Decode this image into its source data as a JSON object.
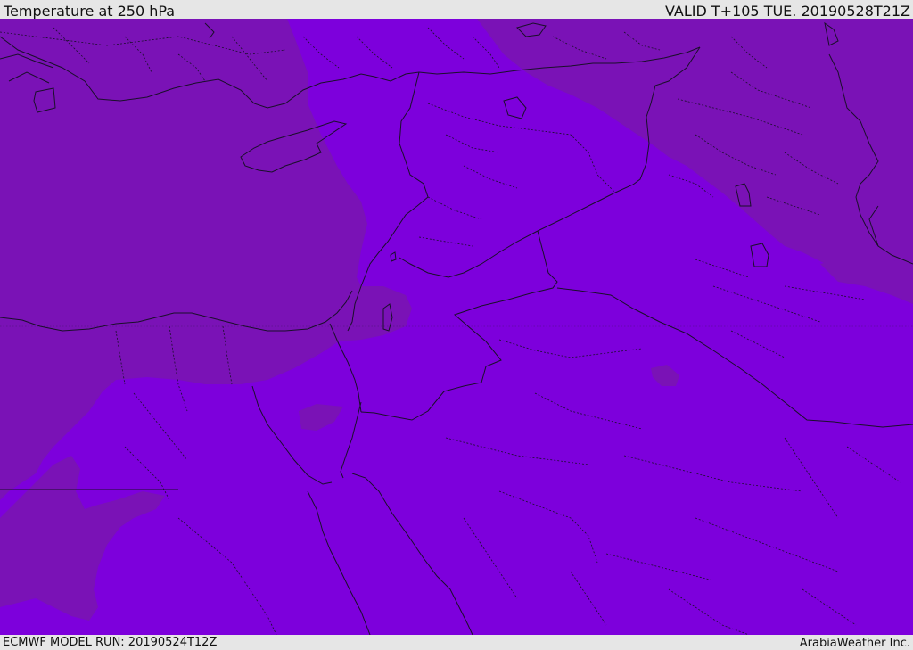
{
  "header": {
    "title": "Temperature at 250 hPa",
    "valid": "VALID T+105 TUE. 20190528T21Z"
  },
  "footer": {
    "model_run": "ECMWF MODEL RUN: 20190524T12Z",
    "brand": "ArabiaWeather Inc."
  },
  "map": {
    "colors": {
      "cooler_band": "#7a12b6",
      "warmer_band": "#7d00dc",
      "lines": "#1a0f2a"
    }
  }
}
